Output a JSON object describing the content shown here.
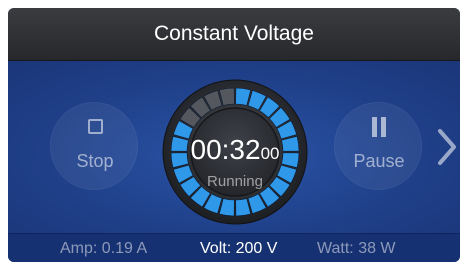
{
  "header": {
    "title": "Constant Voltage"
  },
  "controls": {
    "stop_label": "Stop",
    "pause_label": "Pause"
  },
  "dial": {
    "time_main": "00:32",
    "time_fraction": "00",
    "state": "Running",
    "segments_total": 24,
    "segments_elapsed": 4,
    "elapsed_color": "#54585e",
    "remaining_color": "#2f98e8"
  },
  "status": {
    "amp": "Amp: 0.19 A",
    "volt": "Volt: 200 V",
    "watt": "Watt: 38 W"
  },
  "colors": {
    "background": "#1f3f86",
    "title_bar": "#2e3033",
    "accent": "#2f98e8"
  }
}
